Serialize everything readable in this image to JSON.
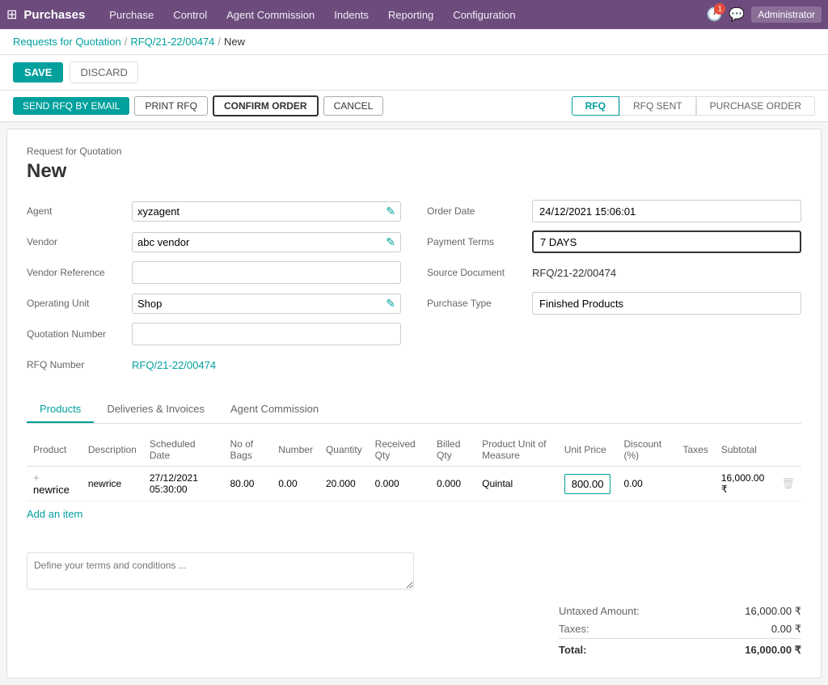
{
  "app": {
    "title": "Purchases",
    "grid_icon": "⊞"
  },
  "topnav": {
    "items": [
      {
        "label": "Purchase",
        "key": "purchase"
      },
      {
        "label": "Control",
        "key": "control"
      },
      {
        "label": "Agent Commission",
        "key": "agent-commission"
      },
      {
        "label": "Indents",
        "key": "indents"
      },
      {
        "label": "Reporting",
        "key": "reporting"
      },
      {
        "label": "Configuration",
        "key": "configuration"
      }
    ],
    "user_label": "Administrator"
  },
  "breadcrumb": {
    "items": [
      {
        "label": "Requests for Quotation",
        "link": true
      },
      {
        "label": "RFQ/21-22/00474",
        "link": true
      },
      {
        "label": "New",
        "link": false
      }
    ]
  },
  "action_bar": {
    "save_label": "SAVE",
    "discard_label": "DISCARD"
  },
  "status_bar": {
    "send_rfq_label": "SEND RFQ BY EMAIL",
    "print_rfq_label": "PRINT RFQ",
    "confirm_order_label": "CONFIRM ORDER",
    "cancel_label": "CANCEL",
    "steps": [
      {
        "label": "RFQ",
        "active": true
      },
      {
        "label": "RFQ SENT",
        "active": false
      },
      {
        "label": "PURCHASE ORDER",
        "active": false
      }
    ]
  },
  "form": {
    "subtitle": "Request for Quotation",
    "title": "New",
    "left": {
      "agent_label": "Agent",
      "agent_value": "xyzagent",
      "vendor_label": "Vendor",
      "vendor_value": "abc vendor",
      "vendor_ref_label": "Vendor Reference",
      "vendor_ref_value": "",
      "operating_unit_label": "Operating Unit",
      "operating_unit_value": "Shop",
      "quotation_number_label": "Quotation Number",
      "quotation_number_value": "",
      "rfq_number_label": "RFQ Number",
      "rfq_number_value": "RFQ/21-22/00474"
    },
    "right": {
      "order_date_label": "Order Date",
      "order_date_value": "24/12/2021 15:06:01",
      "payment_terms_label": "Payment Terms",
      "payment_terms_value": "7 DAYS",
      "source_doc_label": "Source Document",
      "source_doc_value": "RFQ/21-22/00474",
      "purchase_type_label": "Purchase Type",
      "purchase_type_value": "Finished Products"
    }
  },
  "tabs": [
    {
      "label": "Products",
      "active": true
    },
    {
      "label": "Deliveries & Invoices",
      "active": false
    },
    {
      "label": "Agent Commission",
      "active": false
    }
  ],
  "table": {
    "headers": [
      "Product",
      "Description",
      "Scheduled Date",
      "No of Bags",
      "Number",
      "Quantity",
      "Received Qty",
      "Billed Qty",
      "Product Unit of Measure",
      "Unit Price",
      "Discount (%)",
      "Taxes",
      "Subtotal"
    ],
    "rows": [
      {
        "product": "newrice",
        "description": "newrice",
        "scheduled_date": "27/12/2021 05:30:00",
        "no_of_bags": "80.00",
        "number": "0.00",
        "quantity": "20.000",
        "received_qty": "0.000",
        "billed_qty": "0.000",
        "uom": "Quintal",
        "unit_price": "800.00",
        "discount": "0.00",
        "taxes": "",
        "subtotal": "16,000.00 ₹"
      }
    ],
    "add_item_label": "Add an item"
  },
  "terms": {
    "placeholder": "Define your terms and conditions ..."
  },
  "totals": {
    "untaxed_label": "Untaxed Amount:",
    "untaxed_value": "16,000.00 ₹",
    "taxes_label": "Taxes:",
    "taxes_value": "0.00 ₹",
    "total_label": "Total:",
    "total_value": "16,000.00 ₹"
  }
}
